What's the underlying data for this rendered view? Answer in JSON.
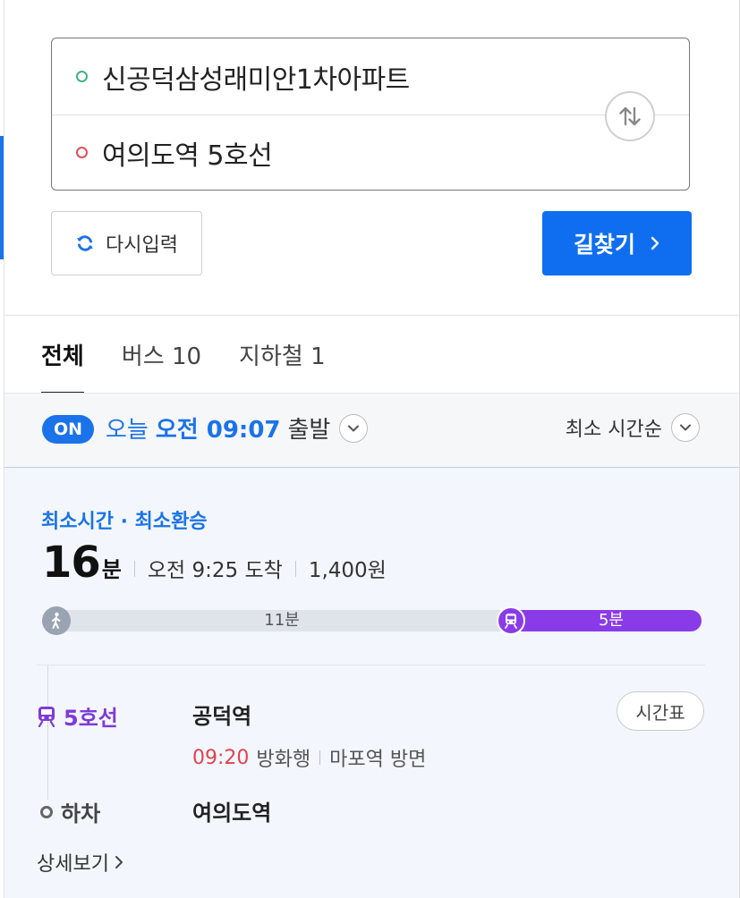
{
  "route": {
    "start": "신공덕삼성래미안1차아파트",
    "end": "여의도역 5호선"
  },
  "actions": {
    "reset_label": "다시입력",
    "search_label": "길찾기"
  },
  "tabs": [
    {
      "label": "전체",
      "active": true
    },
    {
      "label": "버스 10",
      "active": false
    },
    {
      "label": "지하철 1",
      "active": false
    }
  ],
  "departure": {
    "badge": "ON",
    "day": "오늘",
    "time": "오전 09:07",
    "suffix": "출발",
    "sort": "최소 시간순"
  },
  "result": {
    "tag": "최소시간 · 최소환승",
    "duration_num": "16",
    "duration_unit": "분",
    "arrival": "오전 9:25 도착",
    "fare": "1,400원",
    "walk_duration": "11분",
    "subway_duration": "5분",
    "segment": {
      "line": "5호선",
      "line_color": "#7e3bd9",
      "station": "공덕역",
      "timetable_label": "시간표",
      "depart_time": "09:20",
      "direction": "방화행",
      "platform": "마포역 방면"
    },
    "alight": {
      "label": "하차",
      "station": "여의도역"
    },
    "detail_label": "상세보기"
  },
  "colors": {
    "accent": "#1a73e8",
    "primary_button": "#0f6ef0",
    "subway_line5": "#8a3be8",
    "time_red": "#e0424e"
  }
}
